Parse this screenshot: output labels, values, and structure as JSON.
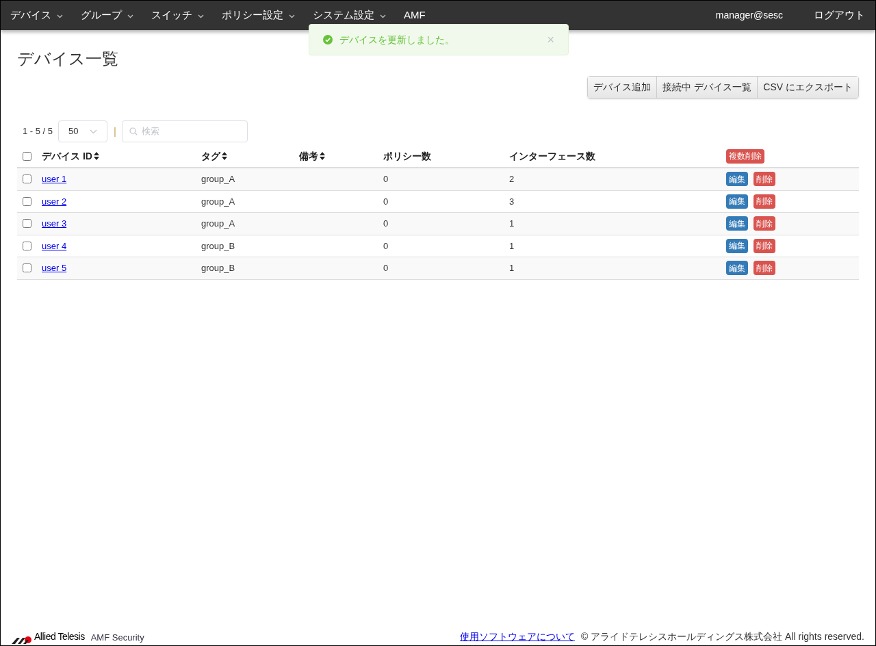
{
  "nav": {
    "items": [
      {
        "label": "デバイス",
        "dropdown": true
      },
      {
        "label": "グループ",
        "dropdown": true
      },
      {
        "label": "スイッチ",
        "dropdown": true
      },
      {
        "label": "ポリシー設定",
        "dropdown": true
      },
      {
        "label": "システム設定",
        "dropdown": true
      },
      {
        "label": "AMF",
        "dropdown": false
      }
    ],
    "user": "manager@sesc",
    "logout": "ログアウト"
  },
  "toast": {
    "message": "デバイスを更新しました。",
    "close": "×"
  },
  "page_title": "デバイス一覧",
  "actions": [
    "デバイス追加",
    "接続中 デバイス一覧",
    "CSV にエクスポート"
  ],
  "toolbar": {
    "range": "1 - 5 / 5",
    "per_page": "50",
    "separator": "|",
    "search_placeholder": "検索"
  },
  "table": {
    "select_all_checked": false,
    "columns": [
      {
        "label": "デバイス ID",
        "sortable": true
      },
      {
        "label": "タグ",
        "sortable": true
      },
      {
        "label": "備考",
        "sortable": true
      },
      {
        "label": "ポリシー数",
        "sortable": false
      },
      {
        "label": "インターフェース数",
        "sortable": false
      }
    ],
    "bulk_delete": "複数削除",
    "rows": [
      {
        "id": "user 1",
        "tag": "group_A",
        "note": "",
        "policies": "0",
        "interfaces": "2",
        "checked": false,
        "edit": "編集",
        "delete": "削除"
      },
      {
        "id": "user 2",
        "tag": "group_A",
        "note": "",
        "policies": "0",
        "interfaces": "3",
        "checked": false,
        "edit": "編集",
        "delete": "削除"
      },
      {
        "id": "user 3",
        "tag": "group_A",
        "note": "",
        "policies": "0",
        "interfaces": "1",
        "checked": false,
        "edit": "編集",
        "delete": "削除"
      },
      {
        "id": "user 4",
        "tag": "group_B",
        "note": "",
        "policies": "0",
        "interfaces": "1",
        "checked": false,
        "edit": "編集",
        "delete": "削除"
      },
      {
        "id": "user 5",
        "tag": "group_B",
        "note": "",
        "policies": "0",
        "interfaces": "1",
        "checked": false,
        "edit": "編集",
        "delete": "削除"
      }
    ]
  },
  "footer": {
    "brand": "Allied Telesis",
    "product": "AMF Security",
    "link": "使用ソフトウェアについて",
    "copyright": "© アライドテレシスホールディングス株式会社 All rights reserved."
  }
}
